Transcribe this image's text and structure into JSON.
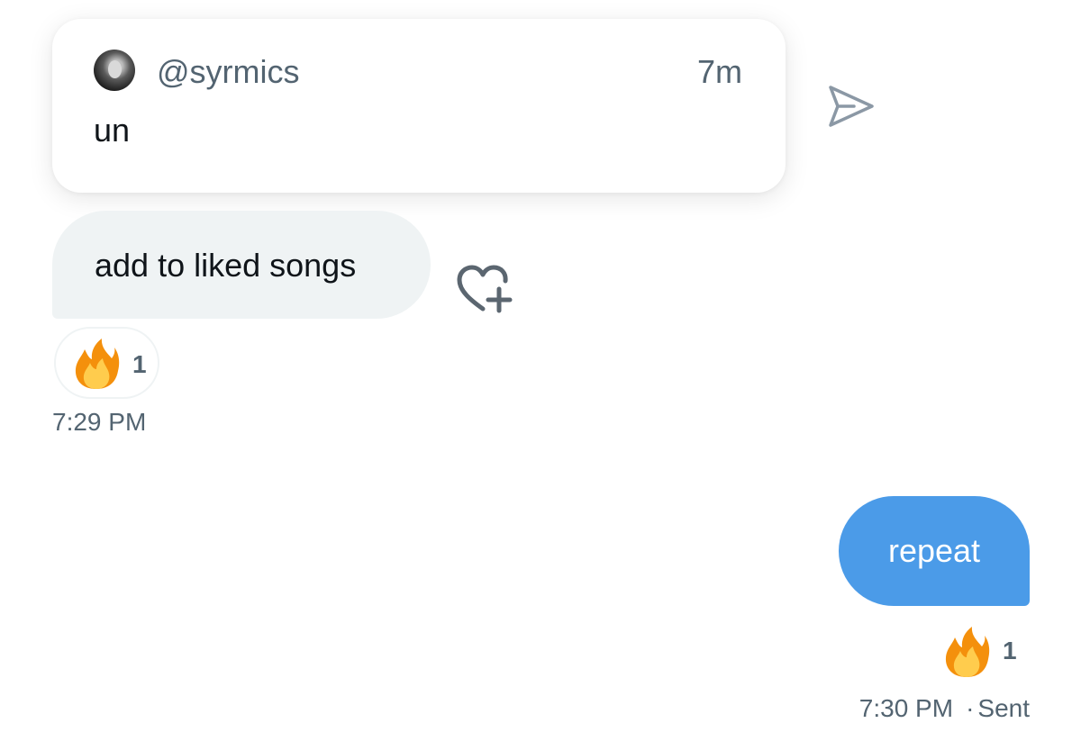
{
  "quoted_tweet": {
    "handle": "@syrmics",
    "time": "7m",
    "text": "un"
  },
  "received_message": {
    "text": "add to liked songs",
    "reaction": {
      "emoji": "fire-icon",
      "count": "1"
    },
    "timestamp": "7:29 PM"
  },
  "sent_message": {
    "text": "repeat",
    "reaction": {
      "emoji": "fire-icon",
      "count": "1"
    },
    "timestamp": "7:30 PM",
    "separator": "·",
    "status": "Sent"
  },
  "icons": {
    "share": "share-icon",
    "like": "heart-plus-icon"
  },
  "colors": {
    "sent_bubble": "#4b9be8",
    "received_bubble": "#eff3f4",
    "secondary_text": "#536471",
    "icon_color": "#8b98a5"
  }
}
